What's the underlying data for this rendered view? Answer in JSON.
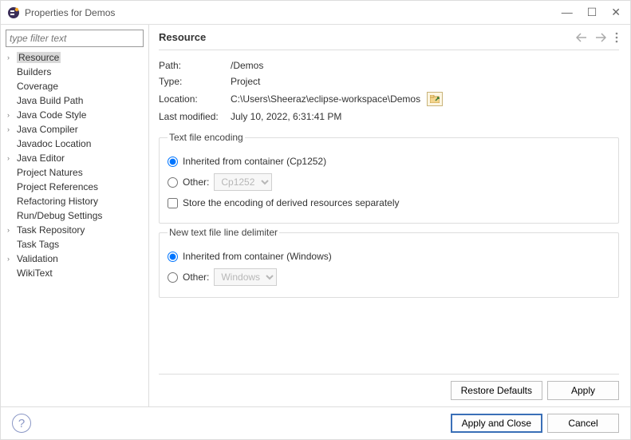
{
  "window": {
    "title": "Properties for Demos"
  },
  "sidebar": {
    "filter_placeholder": "type filter text",
    "items": [
      {
        "label": "Resource",
        "expandable": true,
        "selected": true
      },
      {
        "label": "Builders",
        "expandable": false
      },
      {
        "label": "Coverage",
        "expandable": false
      },
      {
        "label": "Java Build Path",
        "expandable": false
      },
      {
        "label": "Java Code Style",
        "expandable": true
      },
      {
        "label": "Java Compiler",
        "expandable": true
      },
      {
        "label": "Javadoc Location",
        "expandable": false
      },
      {
        "label": "Java Editor",
        "expandable": true
      },
      {
        "label": "Project Natures",
        "expandable": false
      },
      {
        "label": "Project References",
        "expandable": false
      },
      {
        "label": "Refactoring History",
        "expandable": false
      },
      {
        "label": "Run/Debug Settings",
        "expandable": false
      },
      {
        "label": "Task Repository",
        "expandable": true
      },
      {
        "label": "Task Tags",
        "expandable": false
      },
      {
        "label": "Validation",
        "expandable": true
      },
      {
        "label": "WikiText",
        "expandable": false
      }
    ]
  },
  "page": {
    "title": "Resource",
    "path_label": "Path:",
    "path_value": "/Demos",
    "type_label": "Type:",
    "type_value": "Project",
    "location_label": "Location:",
    "location_value": "C:\\Users\\Sheeraz\\eclipse-workspace\\Demos",
    "modified_label": "Last modified:",
    "modified_value": "July 10, 2022, 6:31:41 PM"
  },
  "encoding": {
    "legend": "Text file encoding",
    "inherited_label": "Inherited from container (Cp1252)",
    "other_label": "Other:",
    "other_value": "Cp1252",
    "store_derived_label": "Store the encoding of derived resources separately",
    "inherited_checked": true,
    "store_derived_checked": false
  },
  "delimiter": {
    "legend": "New text file line delimiter",
    "inherited_label": "Inherited from container (Windows)",
    "other_label": "Other:",
    "other_value": "Windows",
    "inherited_checked": true
  },
  "buttons": {
    "restore": "Restore Defaults",
    "apply": "Apply",
    "apply_close": "Apply and Close",
    "cancel": "Cancel"
  }
}
